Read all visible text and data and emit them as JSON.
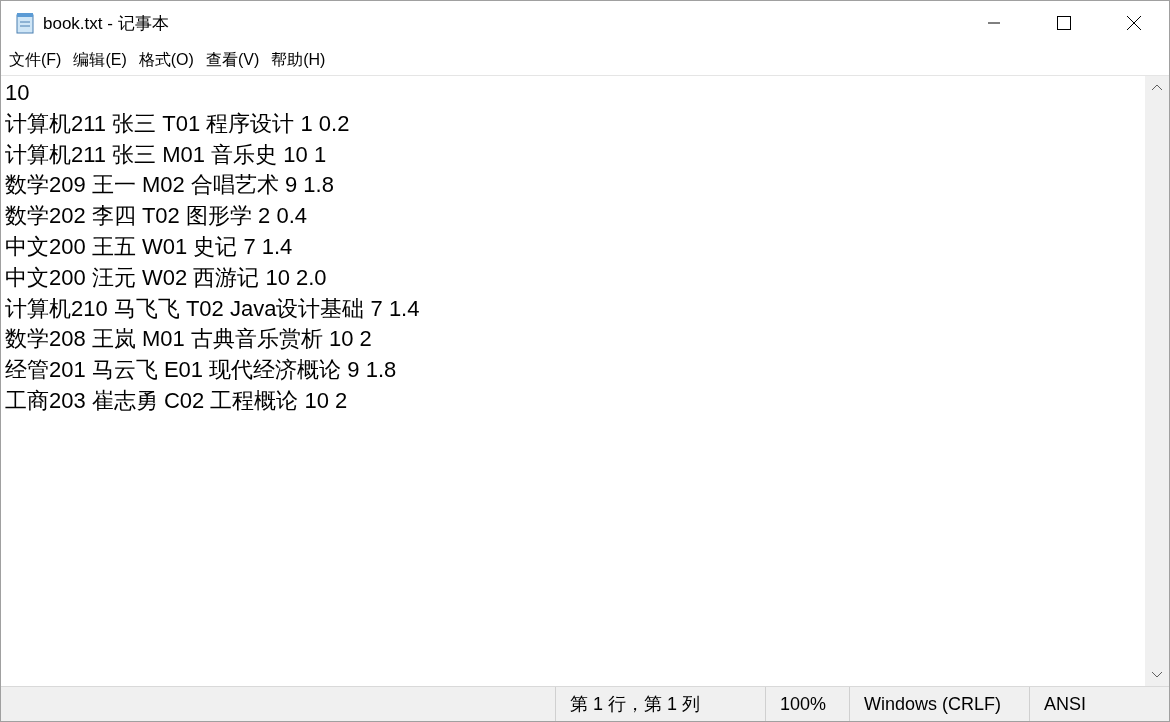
{
  "window": {
    "title": "book.txt - 记事本"
  },
  "menu": [
    "文件(F)",
    "编辑(E)",
    "格式(O)",
    "查看(V)",
    "帮助(H)"
  ],
  "document": {
    "lines": [
      "10",
      "计算机211 张三 T01 程序设计 1 0.2",
      "计算机211 张三 M01 音乐史 10 1",
      "数学209 王一 M02 合唱艺术 9 1.8",
      "数学202 李四 T02 图形学 2 0.4",
      "中文200 王五 W01 史记 7 1.4",
      "中文200 汪元 W02 西游记 10 2.0",
      "计算机210 马飞飞 T02 Java设计基础 7 1.4",
      "数学208 王岚 M01 古典音乐赏析 10 2",
      "经管201 马云飞 E01 现代经济概论 9 1.8",
      "工商203 崔志勇 C02 工程概论 10 2"
    ]
  },
  "status_bar": [
    "第 1 行，第 1 列",
    "100%",
    "Windows (CRLF)",
    "ANSI"
  ]
}
